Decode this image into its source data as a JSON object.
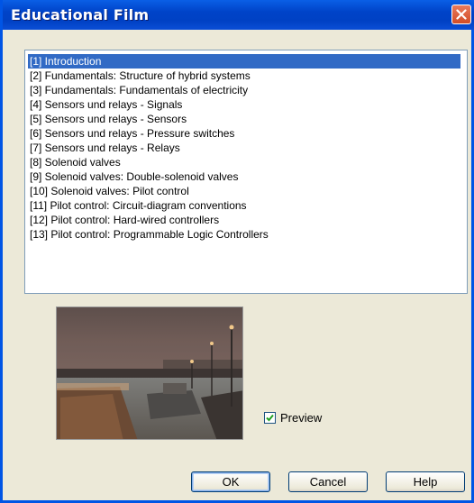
{
  "window": {
    "title": "Educational Film"
  },
  "list": {
    "items": [
      "[1] Introduction",
      "[2] Fundamentals: Structure of hybrid systems",
      "[3] Fundamentals: Fundamentals of electricity",
      "[4] Sensors und relays - Signals",
      "[5] Sensors und relays - Sensors",
      "[6] Sensors und relays - Pressure switches",
      "[7] Sensors und relays - Relays",
      "[8] Solenoid valves",
      "[9] Solenoid valves: Double-solenoid valves",
      "[10] Solenoid valves: Pilot control",
      "[11] Pilot control: Circuit-diagram conventions",
      "[12] Pilot control: Hard-wired controllers",
      "[13] Pilot control: Programmable Logic Controllers"
    ],
    "selected_index": 0
  },
  "preview": {
    "checkbox_label": "Preview",
    "checked": true
  },
  "buttons": {
    "ok": "OK",
    "cancel": "Cancel",
    "help": "Help"
  },
  "colors": {
    "titlebar": "#0a4ed6",
    "selection": "#316ac5",
    "close_button": "#d24d26",
    "face": "#ece9d8"
  }
}
